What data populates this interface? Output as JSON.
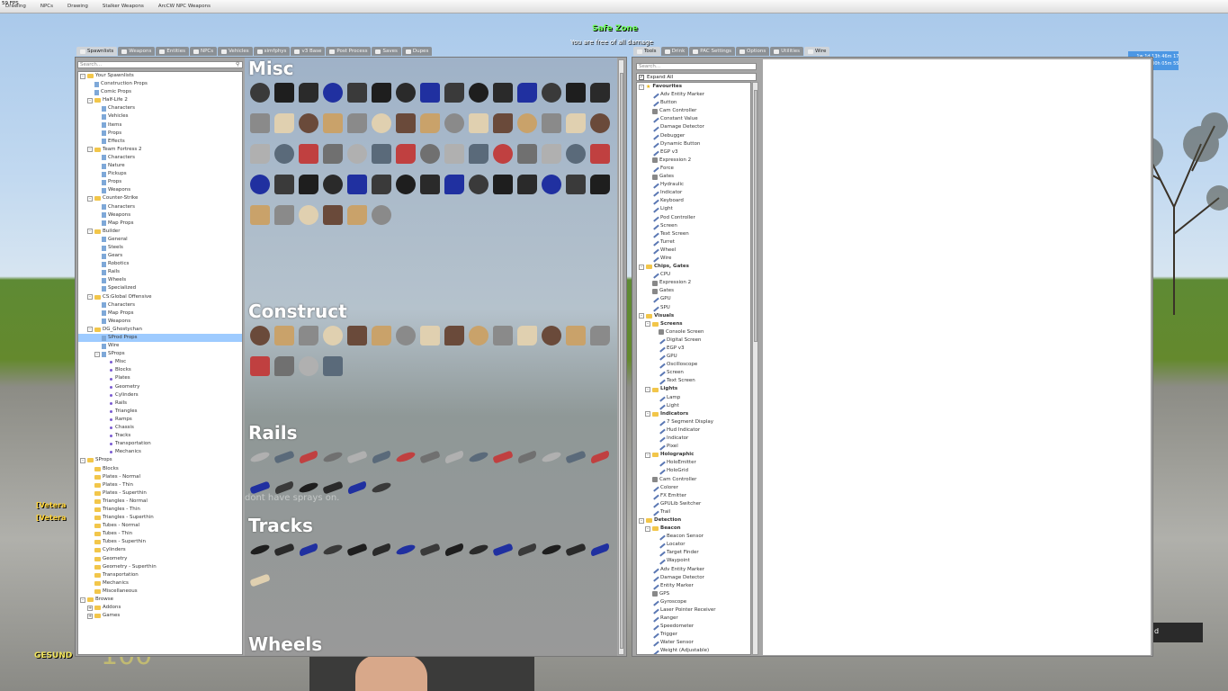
{
  "topbar": {
    "fps": "59 FPS",
    "menus": [
      "Drawing",
      "NPCs",
      "Drawing",
      "Stalker Weapons",
      "ArcCW NPC Weapons"
    ]
  },
  "hud": {
    "safe_zone_title": "Safe Zone",
    "safe_zone_sub": "You are free of all damage",
    "time_panel": [
      "...  1w 1d 13h 46m 17s",
      "...  0w 0d 00h 05m 55s"
    ],
    "vet1": "[Vetera",
    "vet2": "[Vetera",
    "health_label": "GESUND",
    "health_value": "100",
    "chat_fragment": "dont have sprays on.",
    "right_box": "d"
  },
  "spawnmenu": {
    "tabs": [
      {
        "label": "Spawnlists",
        "active": true
      },
      {
        "label": "Weapons"
      },
      {
        "label": "Entities"
      },
      {
        "label": "NPCs"
      },
      {
        "label": "Vehicles"
      },
      {
        "label": "simfphys"
      },
      {
        "label": "v3 Base"
      },
      {
        "label": "Post Process"
      },
      {
        "label": "Saves"
      },
      {
        "label": "Dupes"
      }
    ],
    "search_placeholder": "Search...",
    "tree": [
      {
        "d": 0,
        "t": "Your Spawnlists",
        "i": "fold",
        "e": "-"
      },
      {
        "d": 1,
        "t": "Construction Props",
        "i": "file"
      },
      {
        "d": 1,
        "t": "Comic Props",
        "i": "file"
      },
      {
        "d": 1,
        "t": "Half-Life 2",
        "i": "fold",
        "e": "-"
      },
      {
        "d": 2,
        "t": "Characters",
        "i": "file"
      },
      {
        "d": 2,
        "t": "Vehicles",
        "i": "file"
      },
      {
        "d": 2,
        "t": "Items",
        "i": "file"
      },
      {
        "d": 2,
        "t": "Props",
        "i": "file"
      },
      {
        "d": 2,
        "t": "Effects",
        "i": "file"
      },
      {
        "d": 1,
        "t": "Team Fortress 2",
        "i": "fold",
        "e": "-"
      },
      {
        "d": 2,
        "t": "Characters",
        "i": "file"
      },
      {
        "d": 2,
        "t": "Nature",
        "i": "file"
      },
      {
        "d": 2,
        "t": "Pickups",
        "i": "file"
      },
      {
        "d": 2,
        "t": "Props",
        "i": "file"
      },
      {
        "d": 2,
        "t": "Weapons",
        "i": "file"
      },
      {
        "d": 1,
        "t": "Counter-Strike",
        "i": "fold",
        "e": "-"
      },
      {
        "d": 2,
        "t": "Characters",
        "i": "file"
      },
      {
        "d": 2,
        "t": "Weapons",
        "i": "file"
      },
      {
        "d": 2,
        "t": "Map Props",
        "i": "file"
      },
      {
        "d": 1,
        "t": "Builder",
        "i": "fold",
        "e": "-"
      },
      {
        "d": 2,
        "t": "General",
        "i": "file"
      },
      {
        "d": 2,
        "t": "Steels",
        "i": "file"
      },
      {
        "d": 2,
        "t": "Gears",
        "i": "file"
      },
      {
        "d": 2,
        "t": "Robotics",
        "i": "file"
      },
      {
        "d": 2,
        "t": "Rails",
        "i": "file"
      },
      {
        "d": 2,
        "t": "Wheels",
        "i": "file"
      },
      {
        "d": 2,
        "t": "Specialized",
        "i": "file"
      },
      {
        "d": 1,
        "t": "CS:Global Offensive",
        "i": "fold",
        "e": "-"
      },
      {
        "d": 2,
        "t": "Characters",
        "i": "file"
      },
      {
        "d": 2,
        "t": "Map Props",
        "i": "file"
      },
      {
        "d": 2,
        "t": "Weapons",
        "i": "file"
      },
      {
        "d": 1,
        "t": "DG_Ghostychan",
        "i": "fold",
        "e": "-"
      },
      {
        "d": 2,
        "t": "SProd Props",
        "i": "file",
        "sel": true
      },
      {
        "d": 2,
        "t": "Wire",
        "i": "file"
      },
      {
        "d": 2,
        "t": "SProps",
        "i": "file",
        "e": "-"
      },
      {
        "d": 3,
        "t": "Misc",
        "i": "dot"
      },
      {
        "d": 3,
        "t": "Blocks",
        "i": "dot"
      },
      {
        "d": 3,
        "t": "Plates",
        "i": "dot"
      },
      {
        "d": 3,
        "t": "Geometry",
        "i": "dot"
      },
      {
        "d": 3,
        "t": "Cylinders",
        "i": "dot"
      },
      {
        "d": 3,
        "t": "Rails",
        "i": "dot"
      },
      {
        "d": 3,
        "t": "Triangles",
        "i": "dot"
      },
      {
        "d": 3,
        "t": "Ramps",
        "i": "dot"
      },
      {
        "d": 3,
        "t": "Chassis",
        "i": "dot"
      },
      {
        "d": 3,
        "t": "Tracks",
        "i": "dot"
      },
      {
        "d": 3,
        "t": "Transportation",
        "i": "dot"
      },
      {
        "d": 3,
        "t": "Mechanics",
        "i": "dot"
      },
      {
        "d": 0,
        "t": "SProps",
        "i": "fold",
        "e": "-"
      },
      {
        "d": 1,
        "t": "Blocks",
        "i": "fold"
      },
      {
        "d": 1,
        "t": "Plates - Normal",
        "i": "fold"
      },
      {
        "d": 1,
        "t": "Plates - Thin",
        "i": "fold"
      },
      {
        "d": 1,
        "t": "Plates - Superthin",
        "i": "fold"
      },
      {
        "d": 1,
        "t": "Triangles - Normal",
        "i": "fold"
      },
      {
        "d": 1,
        "t": "Triangles - Thin",
        "i": "fold"
      },
      {
        "d": 1,
        "t": "Triangles - Superthin",
        "i": "fold"
      },
      {
        "d": 1,
        "t": "Tubes - Normal",
        "i": "fold"
      },
      {
        "d": 1,
        "t": "Tubes - Thin",
        "i": "fold"
      },
      {
        "d": 1,
        "t": "Tubes - Superthin",
        "i": "fold"
      },
      {
        "d": 1,
        "t": "Cylinders",
        "i": "fold"
      },
      {
        "d": 1,
        "t": "Geometry",
        "i": "fold"
      },
      {
        "d": 1,
        "t": "Geometry - Superthin",
        "i": "fold"
      },
      {
        "d": 1,
        "t": "Transportation",
        "i": "fold"
      },
      {
        "d": 1,
        "t": "Mechanics",
        "i": "fold"
      },
      {
        "d": 1,
        "t": "Miscellaneous",
        "i": "fold"
      },
      {
        "d": 0,
        "t": "Browse",
        "i": "fold",
        "e": "-"
      },
      {
        "d": 1,
        "t": "Addons",
        "i": "fold",
        "e": "+"
      },
      {
        "d": 1,
        "t": "Games",
        "i": "fold",
        "e": "+"
      }
    ],
    "sections": [
      {
        "title": "Misc",
        "rows": 5,
        "lastRow": 6
      },
      {
        "title": "Construct",
        "rows": 2,
        "lastRow": 4
      },
      {
        "title": "Rails",
        "rows": 2,
        "lastRow": 6
      },
      {
        "title": "Tracks",
        "rows": 2,
        "lastRow": 1
      },
      {
        "title": "Wheels",
        "rows": 0,
        "lastRow": 0
      }
    ]
  },
  "toolmenu": {
    "tabs": [
      {
        "label": "Tools",
        "active": true
      },
      {
        "label": "Drink"
      },
      {
        "label": "PAC Settings"
      },
      {
        "label": "Options"
      },
      {
        "label": "Utilities"
      },
      {
        "label": "Wire",
        "active2": true
      }
    ],
    "search_placeholder": "Search...",
    "expand_all": "Expand All",
    "tree": [
      {
        "d": 0,
        "t": "Favourites",
        "i": "star",
        "e": "-",
        "b": true
      },
      {
        "d": 1,
        "t": "Adv Entity Marker",
        "i": "wr"
      },
      {
        "d": 1,
        "t": "Button",
        "i": "wr"
      },
      {
        "d": 1,
        "t": "Cam Controller",
        "i": "pcb"
      },
      {
        "d": 1,
        "t": "Constant Value",
        "i": "wr"
      },
      {
        "d": 1,
        "t": "Damage Detector",
        "i": "wr"
      },
      {
        "d": 1,
        "t": "Debugger",
        "i": "wr"
      },
      {
        "d": 1,
        "t": "Dynamic Button",
        "i": "wr"
      },
      {
        "d": 1,
        "t": "EGP v3",
        "i": "wr"
      },
      {
        "d": 1,
        "t": "Expression 2",
        "i": "pcb"
      },
      {
        "d": 1,
        "t": "Force",
        "i": "wr"
      },
      {
        "d": 1,
        "t": "Gates",
        "i": "pcb"
      },
      {
        "d": 1,
        "t": "Hydraulic",
        "i": "wr"
      },
      {
        "d": 1,
        "t": "Indicator",
        "i": "wr"
      },
      {
        "d": 1,
        "t": "Keyboard",
        "i": "wr"
      },
      {
        "d": 1,
        "t": "Light",
        "i": "wr"
      },
      {
        "d": 1,
        "t": "Pod Controller",
        "i": "wr"
      },
      {
        "d": 1,
        "t": "Screen",
        "i": "wr"
      },
      {
        "d": 1,
        "t": "Text Screen",
        "i": "wr"
      },
      {
        "d": 1,
        "t": "Turret",
        "i": "wr"
      },
      {
        "d": 1,
        "t": "Wheel",
        "i": "wr"
      },
      {
        "d": 1,
        "t": "Wire",
        "i": "wr"
      },
      {
        "d": 0,
        "t": "Chips, Gates",
        "i": "fold",
        "e": "-",
        "b": true
      },
      {
        "d": 1,
        "t": "CPU",
        "i": "wr"
      },
      {
        "d": 1,
        "t": "Expression 2",
        "i": "pcb"
      },
      {
        "d": 1,
        "t": "Gates",
        "i": "pcb"
      },
      {
        "d": 1,
        "t": "GPU",
        "i": "wr"
      },
      {
        "d": 1,
        "t": "SPU",
        "i": "wr"
      },
      {
        "d": 0,
        "t": "Visuals",
        "i": "fold",
        "e": "-",
        "b": true
      },
      {
        "d": 1,
        "t": "Screens",
        "i": "fold",
        "e": "-",
        "b": true
      },
      {
        "d": 2,
        "t": "Console Screen",
        "i": "pcb"
      },
      {
        "d": 2,
        "t": "Digital Screen",
        "i": "wr"
      },
      {
        "d": 2,
        "t": "EGP v3",
        "i": "wr"
      },
      {
        "d": 2,
        "t": "GPU",
        "i": "wr"
      },
      {
        "d": 2,
        "t": "Oscilloscope",
        "i": "wr"
      },
      {
        "d": 2,
        "t": "Screen",
        "i": "wr"
      },
      {
        "d": 2,
        "t": "Text Screen",
        "i": "wr"
      },
      {
        "d": 1,
        "t": "Lights",
        "i": "fold",
        "e": "-",
        "b": true
      },
      {
        "d": 2,
        "t": "Lamp",
        "i": "wr"
      },
      {
        "d": 2,
        "t": "Light",
        "i": "wr"
      },
      {
        "d": 1,
        "t": "Indicators",
        "i": "fold",
        "e": "-",
        "b": true
      },
      {
        "d": 2,
        "t": "7 Segment Display",
        "i": "wr"
      },
      {
        "d": 2,
        "t": "Hud Indicator",
        "i": "wr"
      },
      {
        "d": 2,
        "t": "Indicator",
        "i": "wr"
      },
      {
        "d": 2,
        "t": "Pixel",
        "i": "wr"
      },
      {
        "d": 1,
        "t": "Holographic",
        "i": "fold",
        "e": "-",
        "b": true
      },
      {
        "d": 2,
        "t": "HoloEmitter",
        "i": "wr"
      },
      {
        "d": 2,
        "t": "HoloGrid",
        "i": "wr"
      },
      {
        "d": 1,
        "t": "Cam Controller",
        "i": "pcb"
      },
      {
        "d": 1,
        "t": "Colorer",
        "i": "wr"
      },
      {
        "d": 1,
        "t": "FX Emitter",
        "i": "wr"
      },
      {
        "d": 1,
        "t": "GPULib Switcher",
        "i": "wr"
      },
      {
        "d": 1,
        "t": "Trail",
        "i": "wr"
      },
      {
        "d": 0,
        "t": "Detection",
        "i": "fold",
        "e": "-",
        "b": true
      },
      {
        "d": 1,
        "t": "Beacon",
        "i": "fold",
        "e": "-",
        "b": true
      },
      {
        "d": 2,
        "t": "Beacon Sensor",
        "i": "wr"
      },
      {
        "d": 2,
        "t": "Locator",
        "i": "wr"
      },
      {
        "d": 2,
        "t": "Target Finder",
        "i": "wr"
      },
      {
        "d": 2,
        "t": "Waypoint",
        "i": "wr"
      },
      {
        "d": 1,
        "t": "Adv Entity Marker",
        "i": "wr"
      },
      {
        "d": 1,
        "t": "Damage Detector",
        "i": "wr"
      },
      {
        "d": 1,
        "t": "Entity Marker",
        "i": "wr"
      },
      {
        "d": 1,
        "t": "GPS",
        "i": "pcb"
      },
      {
        "d": 1,
        "t": "Gyroscope",
        "i": "wr"
      },
      {
        "d": 1,
        "t": "Laser Pointer Receiver",
        "i": "wr"
      },
      {
        "d": 1,
        "t": "Ranger",
        "i": "wr"
      },
      {
        "d": 1,
        "t": "Speedometer",
        "i": "wr"
      },
      {
        "d": 1,
        "t": "Trigger",
        "i": "wr"
      },
      {
        "d": 1,
        "t": "Water Sensor",
        "i": "wr"
      },
      {
        "d": 1,
        "t": "Weight (Adjustable)",
        "i": "wr"
      }
    ]
  }
}
